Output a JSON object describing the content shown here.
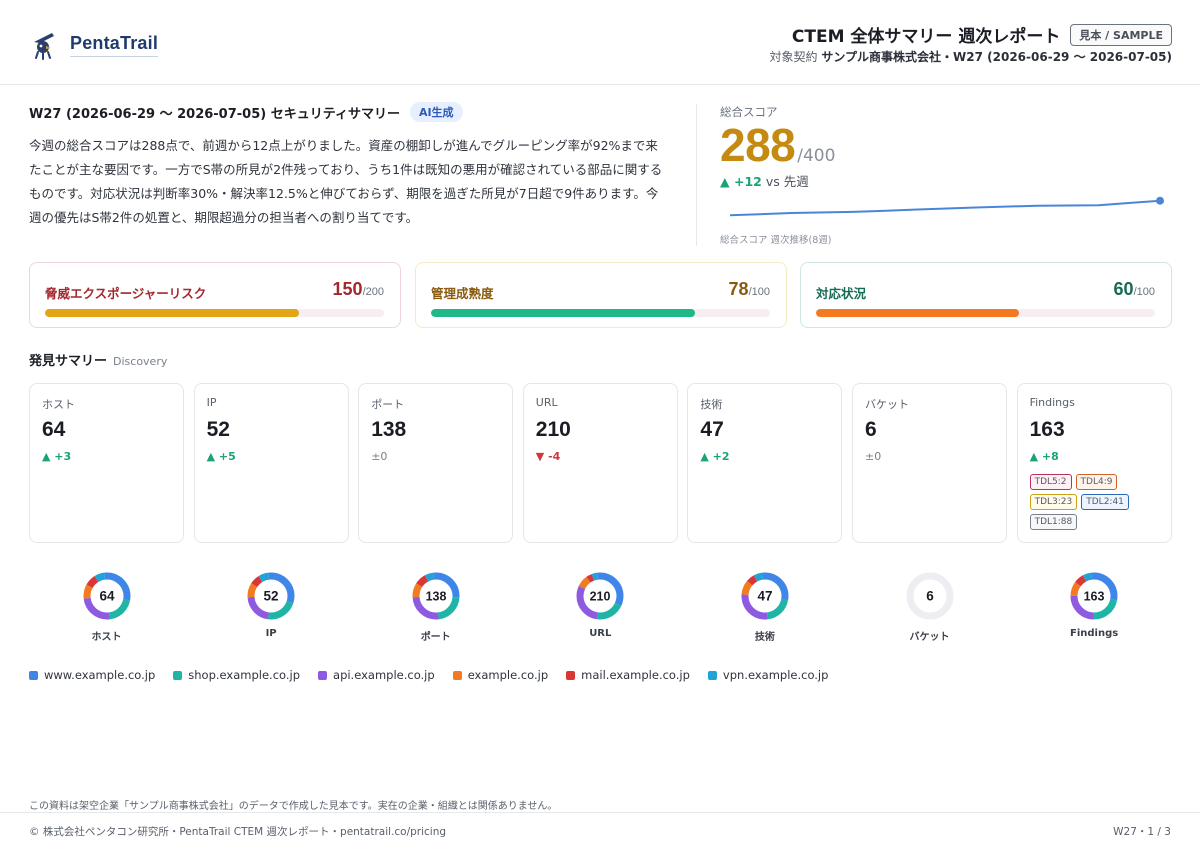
{
  "header": {
    "logo_text": "PentaTrail",
    "title": "CTEM 全体サマリー 週次レポート",
    "sample_badge": "見本 / SAMPLE",
    "subtitle_prefix": "対象契約",
    "subtitle_company": "サンプル商事株式会社・W27 (2026-06-29 〜 2026-07-05)"
  },
  "summary": {
    "title": "W27 (2026-06-29 〜 2026-07-05) セキュリティサマリー",
    "ai_badge": "AI生成",
    "text": "今週の総合スコアは288点で、前週から12点上がりました。資産の棚卸しが進んでグルーピング率が92%まで来たことが主な要因です。一方でS帯の所見が2件残っており、うち1件は既知の悪用が確認されている部品に関するものです。対応状況は判断率30%・解決率12.5%と伸びておらず、期限を過ぎた所見が7日超で9件あります。今週の優先はS帯2件の処置と、期限超過分の担当者への割り当てです。"
  },
  "score": {
    "label": "総合スコア",
    "value": "288",
    "max": "/400",
    "delta": "▲ +12",
    "delta_suffix": " vs 先週",
    "trend_label": "総合スコア 週次推移(8週)",
    "trend": [
      262,
      266,
      268,
      272,
      276,
      279,
      280,
      288
    ]
  },
  "metrics": [
    {
      "label": "脅威エクスポージャーリスク",
      "value": "150",
      "max": "/200",
      "ratio": 0.75,
      "label_color": "#a3282e",
      "bar_color": "#e1a516",
      "border": "#f2d4d9"
    },
    {
      "label": "管理成熟度",
      "value": "78",
      "max": "/100",
      "ratio": 0.78,
      "label_color": "#8a5a0e",
      "bar_color": "#1fb889",
      "border": "#f3ebc6"
    },
    {
      "label": "対応状況",
      "value": "60",
      "max": "/100",
      "ratio": 0.6,
      "label_color": "#166b54",
      "bar_color": "#f47a22",
      "border": "#cde9df"
    }
  ],
  "discovery": {
    "title": "発見サマリー",
    "subtitle": "Discovery",
    "kpis": [
      {
        "label": "ホスト",
        "value": "64",
        "delta": "▲ +3",
        "dir": "up"
      },
      {
        "label": "IP",
        "value": "52",
        "delta": "▲ +5",
        "dir": "up"
      },
      {
        "label": "ポート",
        "value": "138",
        "delta": "±0",
        "dir": "flat"
      },
      {
        "label": "URL",
        "value": "210",
        "delta": "▼ -4",
        "dir": "down"
      },
      {
        "label": "技術",
        "value": "47",
        "delta": "▲ +2",
        "dir": "up"
      },
      {
        "label": "バケット",
        "value": "6",
        "delta": "±0",
        "dir": "flat"
      },
      {
        "label": "Findings",
        "value": "163",
        "delta": "▲ +8",
        "dir": "up"
      }
    ],
    "tdl": [
      {
        "label": "TDL5:2",
        "color": "#b8325a",
        "bg": "#fdf1f5"
      },
      {
        "label": "TDL4:9",
        "color": "#d0612a",
        "bg": "#fff4ec"
      },
      {
        "label": "TDL3:23",
        "color": "#c9a016",
        "bg": "#fffaea"
      },
      {
        "label": "TDL2:41",
        "color": "#2f66b8",
        "bg": "#eef4ff"
      },
      {
        "label": "TDL1:88",
        "color": "#7a808b",
        "bg": "#f6f7f8"
      }
    ]
  },
  "donuts": [
    {
      "label": "ホスト",
      "value": "64",
      "shares": [
        0.3,
        0.2,
        0.25,
        0.1,
        0.08,
        0.07
      ]
    },
    {
      "label": "IP",
      "value": "52",
      "shares": [
        0.32,
        0.22,
        0.22,
        0.1,
        0.07,
        0.07
      ]
    },
    {
      "label": "ポート",
      "value": "138",
      "shares": [
        0.28,
        0.22,
        0.26,
        0.1,
        0.08,
        0.06
      ]
    },
    {
      "label": "URL",
      "value": "210",
      "shares": [
        0.34,
        0.2,
        0.3,
        0.08,
        0.04,
        0.04
      ]
    },
    {
      "label": "技術",
      "value": "47",
      "shares": [
        0.3,
        0.2,
        0.28,
        0.1,
        0.06,
        0.06
      ]
    },
    {
      "label": "バケット",
      "value": "6",
      "shares": []
    },
    {
      "label": "Findings",
      "value": "163",
      "shares": [
        0.3,
        0.22,
        0.25,
        0.1,
        0.07,
        0.06
      ]
    }
  ],
  "legend": [
    {
      "label": "www.example.co.jp",
      "color": "#3f86e8"
    },
    {
      "label": "shop.example.co.jp",
      "color": "#1fb5a6"
    },
    {
      "label": "api.example.co.jp",
      "color": "#8e5be0"
    },
    {
      "label": "example.co.jp",
      "color": "#f47a22"
    },
    {
      "label": "mail.example.co.jp",
      "color": "#d93636"
    },
    {
      "label": "vpn.example.co.jp",
      "color": "#22a3d6"
    }
  ],
  "footer": {
    "disclaimer": "この資料は架空企業「サンプル商事株式会社」のデータで作成した見本です。実在の企業・組織とは関係ありません。",
    "left": "© 株式会社ペンタコン研究所・PentaTrail CTEM 週次レポート・pentatrail.co/pricing",
    "right": "W27・1 / 3"
  }
}
